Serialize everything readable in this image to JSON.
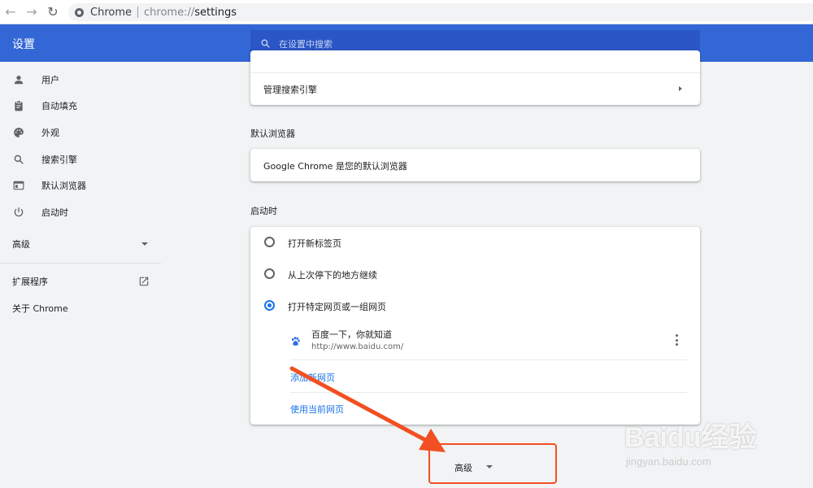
{
  "toolbar": {
    "back_icon": "arrow-left-icon",
    "forward_icon": "arrow-right-icon",
    "reload_icon": "reload-icon",
    "site_name": "Chrome",
    "url_prefix": "chrome://",
    "url_path": "settings"
  },
  "header": {
    "title": "设置",
    "search_placeholder": "在设置中搜索",
    "color": "#3367d6"
  },
  "sidebar": {
    "items": [
      {
        "label": "用户",
        "icon": "person-icon"
      },
      {
        "label": "自动填充",
        "icon": "clipboard-icon"
      },
      {
        "label": "外观",
        "icon": "palette-icon"
      },
      {
        "label": "搜索引擎",
        "icon": "search-icon"
      },
      {
        "label": "默认浏览器",
        "icon": "browser-icon"
      },
      {
        "label": "启动时",
        "icon": "power-icon"
      }
    ],
    "advanced": "高级",
    "extensions": "扩展程序",
    "about": "关于 Chrome"
  },
  "main": {
    "manage_search_engines": "管理搜索引擎",
    "default_browser_title": "默认浏览器",
    "default_browser_text": "Google Chrome 是您的默认浏览器",
    "on_startup_title": "启动时",
    "startup_options": [
      {
        "label": "打开新标签页",
        "checked": false
      },
      {
        "label": "从上次停下的地方继续",
        "checked": false
      },
      {
        "label": "打开特定网页或一组网页",
        "checked": true
      }
    ],
    "site": {
      "title": "百度一下，你就知道",
      "url": "http://www.baidu.com/"
    },
    "add_page_link": "添加新网页",
    "use_current_link": "使用当前网页",
    "advanced_button": "高级"
  },
  "annotation": {
    "color": "#f25022"
  },
  "watermark": {
    "text": "Baidu经验",
    "sub": "jingyan.baidu.com"
  }
}
